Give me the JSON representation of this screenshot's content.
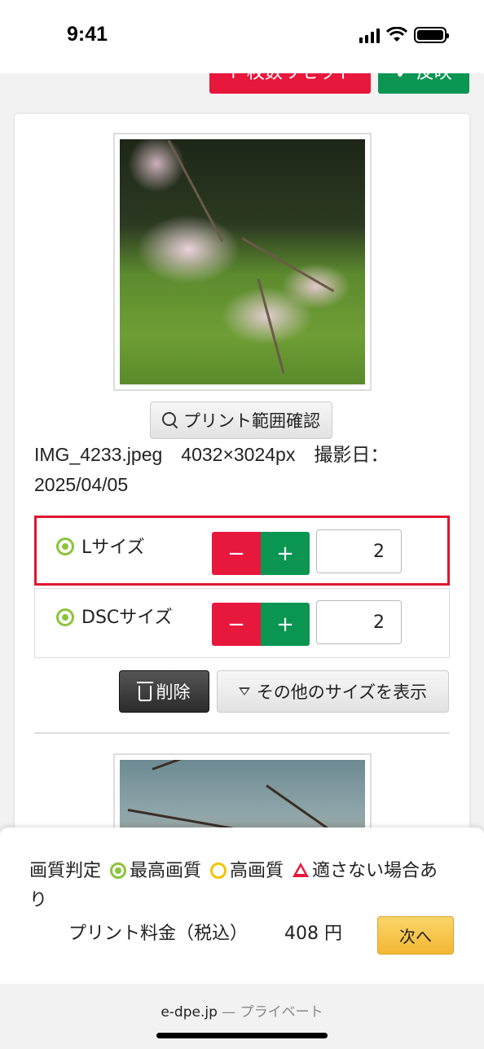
{
  "status_bar": {
    "time": "9:41",
    "icons": [
      "signal-icon",
      "wifi-icon",
      "battery-icon"
    ]
  },
  "top_actions": {
    "reset_label": "↑ 枚数リセット",
    "apply_label": "✔ 反映"
  },
  "photo": {
    "range_check_label": "プリント範囲確認",
    "file_info": "IMG_4233.jpeg　4032×3024px　撮影日：2025/04/05"
  },
  "sizes": [
    {
      "label": "Lサイズ",
      "minus": "−",
      "plus": "+",
      "quantity": "2",
      "quality": "best"
    },
    {
      "label": "DSCサイズ",
      "minus": "−",
      "plus": "+",
      "quantity": "2",
      "quality": "best"
    }
  ],
  "actions": {
    "delete_label": "削除",
    "more_sizes_label": "その他のサイズを表示"
  },
  "bottom": {
    "legend_prefix": "画質判定",
    "best_label": "最高画質",
    "good_label": "高画質",
    "bad_label": "適さない場合あり",
    "price_label": "プリント料金（税込）",
    "price_value": "408 円",
    "next_label": "次へ"
  },
  "browser": {
    "domain": "e-dpe.jp",
    "mode": "— プライベート"
  },
  "colors": {
    "accent_red": "#e8173c",
    "accent_green": "#0b9553",
    "quality_green": "#8cc43b",
    "quality_yellow": "#f4c400",
    "highlight_border": "#e0152f",
    "next_button": "#f4b733"
  }
}
